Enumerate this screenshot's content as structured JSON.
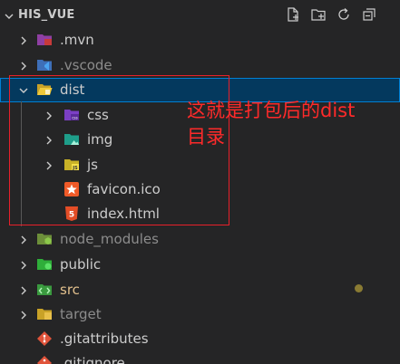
{
  "explorer": {
    "title": "HIS_VUE",
    "actions": [
      "new-file-icon",
      "new-folder-icon",
      "refresh-icon",
      "collapse-all-icon"
    ]
  },
  "tree": {
    "items": [
      {
        "label": ".mvn",
        "icon": "folder-mvn-icon"
      },
      {
        "label": ".vscode",
        "icon": "folder-vscode-icon"
      },
      {
        "label": "dist",
        "icon": "folder-dist-open-icon",
        "selected": true
      },
      {
        "label": "css",
        "icon": "folder-css-icon"
      },
      {
        "label": "img",
        "icon": "folder-images-icon"
      },
      {
        "label": "js",
        "icon": "folder-js-icon"
      },
      {
        "label": "favicon.ico",
        "icon": "favicon-file-icon"
      },
      {
        "label": "index.html",
        "icon": "html-file-icon"
      },
      {
        "label": "node_modules",
        "icon": "folder-node-icon"
      },
      {
        "label": "public",
        "icon": "folder-public-icon"
      },
      {
        "label": "src",
        "icon": "folder-src-icon"
      },
      {
        "label": "target",
        "icon": "folder-target-icon"
      },
      {
        "label": ".gitattributes",
        "icon": "git-file-icon"
      },
      {
        "label": ".gitignore",
        "icon": "git-file-icon"
      }
    ]
  },
  "annotation": {
    "text": "这就是打包后的dist目录",
    "color": "#e8202a"
  },
  "colors": {
    "background": "#252526",
    "selected_row": "#04395e",
    "focus_border": "#007fd4",
    "modified_folder": "#e2c08d"
  }
}
